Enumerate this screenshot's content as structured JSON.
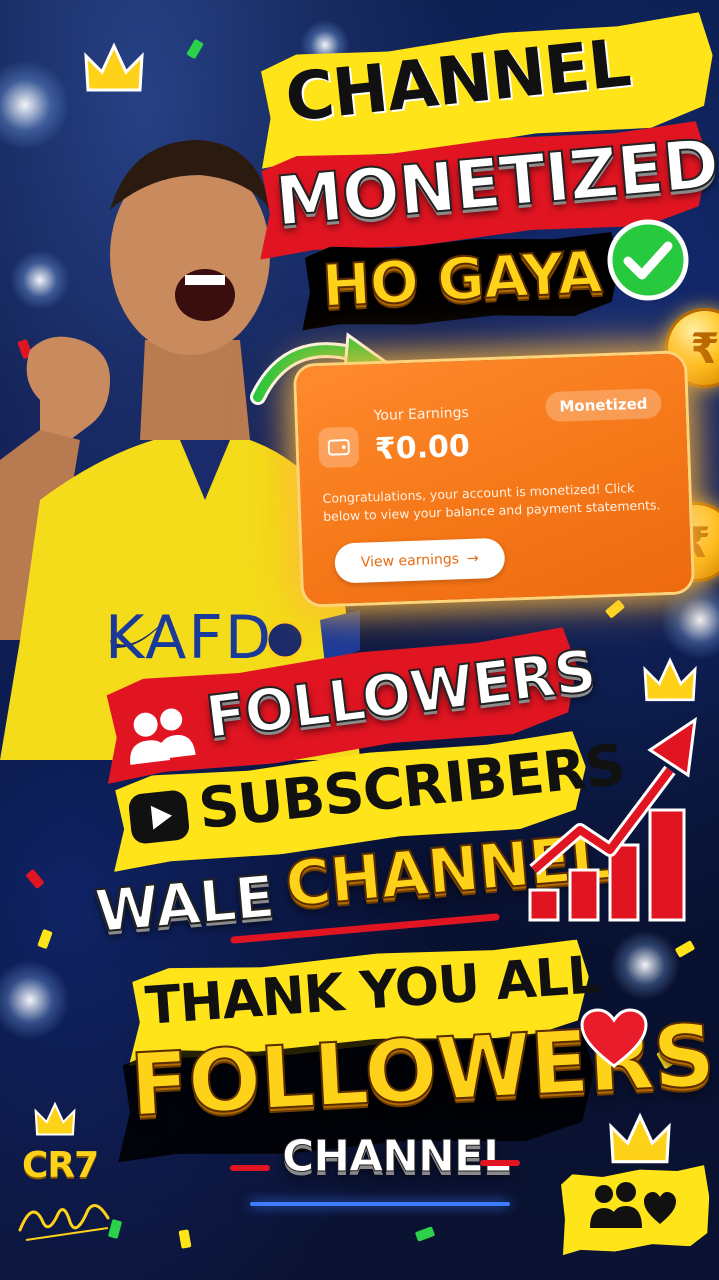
{
  "headline": {
    "line1": "CHANNEL",
    "line2": "MONETIZED",
    "line3": "HO GAYA"
  },
  "earnings_card": {
    "label": "Your Earnings",
    "amount": "₹0.00",
    "badge": "Monetized",
    "message": "Congratulations, your account is monetized! Click below to view your balance and payment statements.",
    "button_label": "View earnings",
    "button_arrow": "→",
    "icon": "wallet-icon"
  },
  "coins": [
    "₹",
    "₹"
  ],
  "promo": {
    "followers": "FOLLOWERS",
    "subscribers": "SUBSCRIBERS",
    "wale": "WALE",
    "channel": "CHANNEL"
  },
  "thanks": {
    "line1": "THANK YOU ALL",
    "line2": "FOLLOWERS",
    "line3": "CHANNEL"
  },
  "branding": {
    "logo": "CR7",
    "jersey_text": "KAFD"
  },
  "icons": [
    "crown-icon",
    "check-icon",
    "green-arrow-icon",
    "followers-icon",
    "play-icon",
    "growth-chart-icon",
    "heart-icon",
    "group-heart-icon",
    "signature-icon"
  ],
  "colors": {
    "yellow": "#ffe41a",
    "red": "#e11522",
    "gold": "#ffd21a",
    "card_orange": "#f57818",
    "green": "#27c93f"
  }
}
